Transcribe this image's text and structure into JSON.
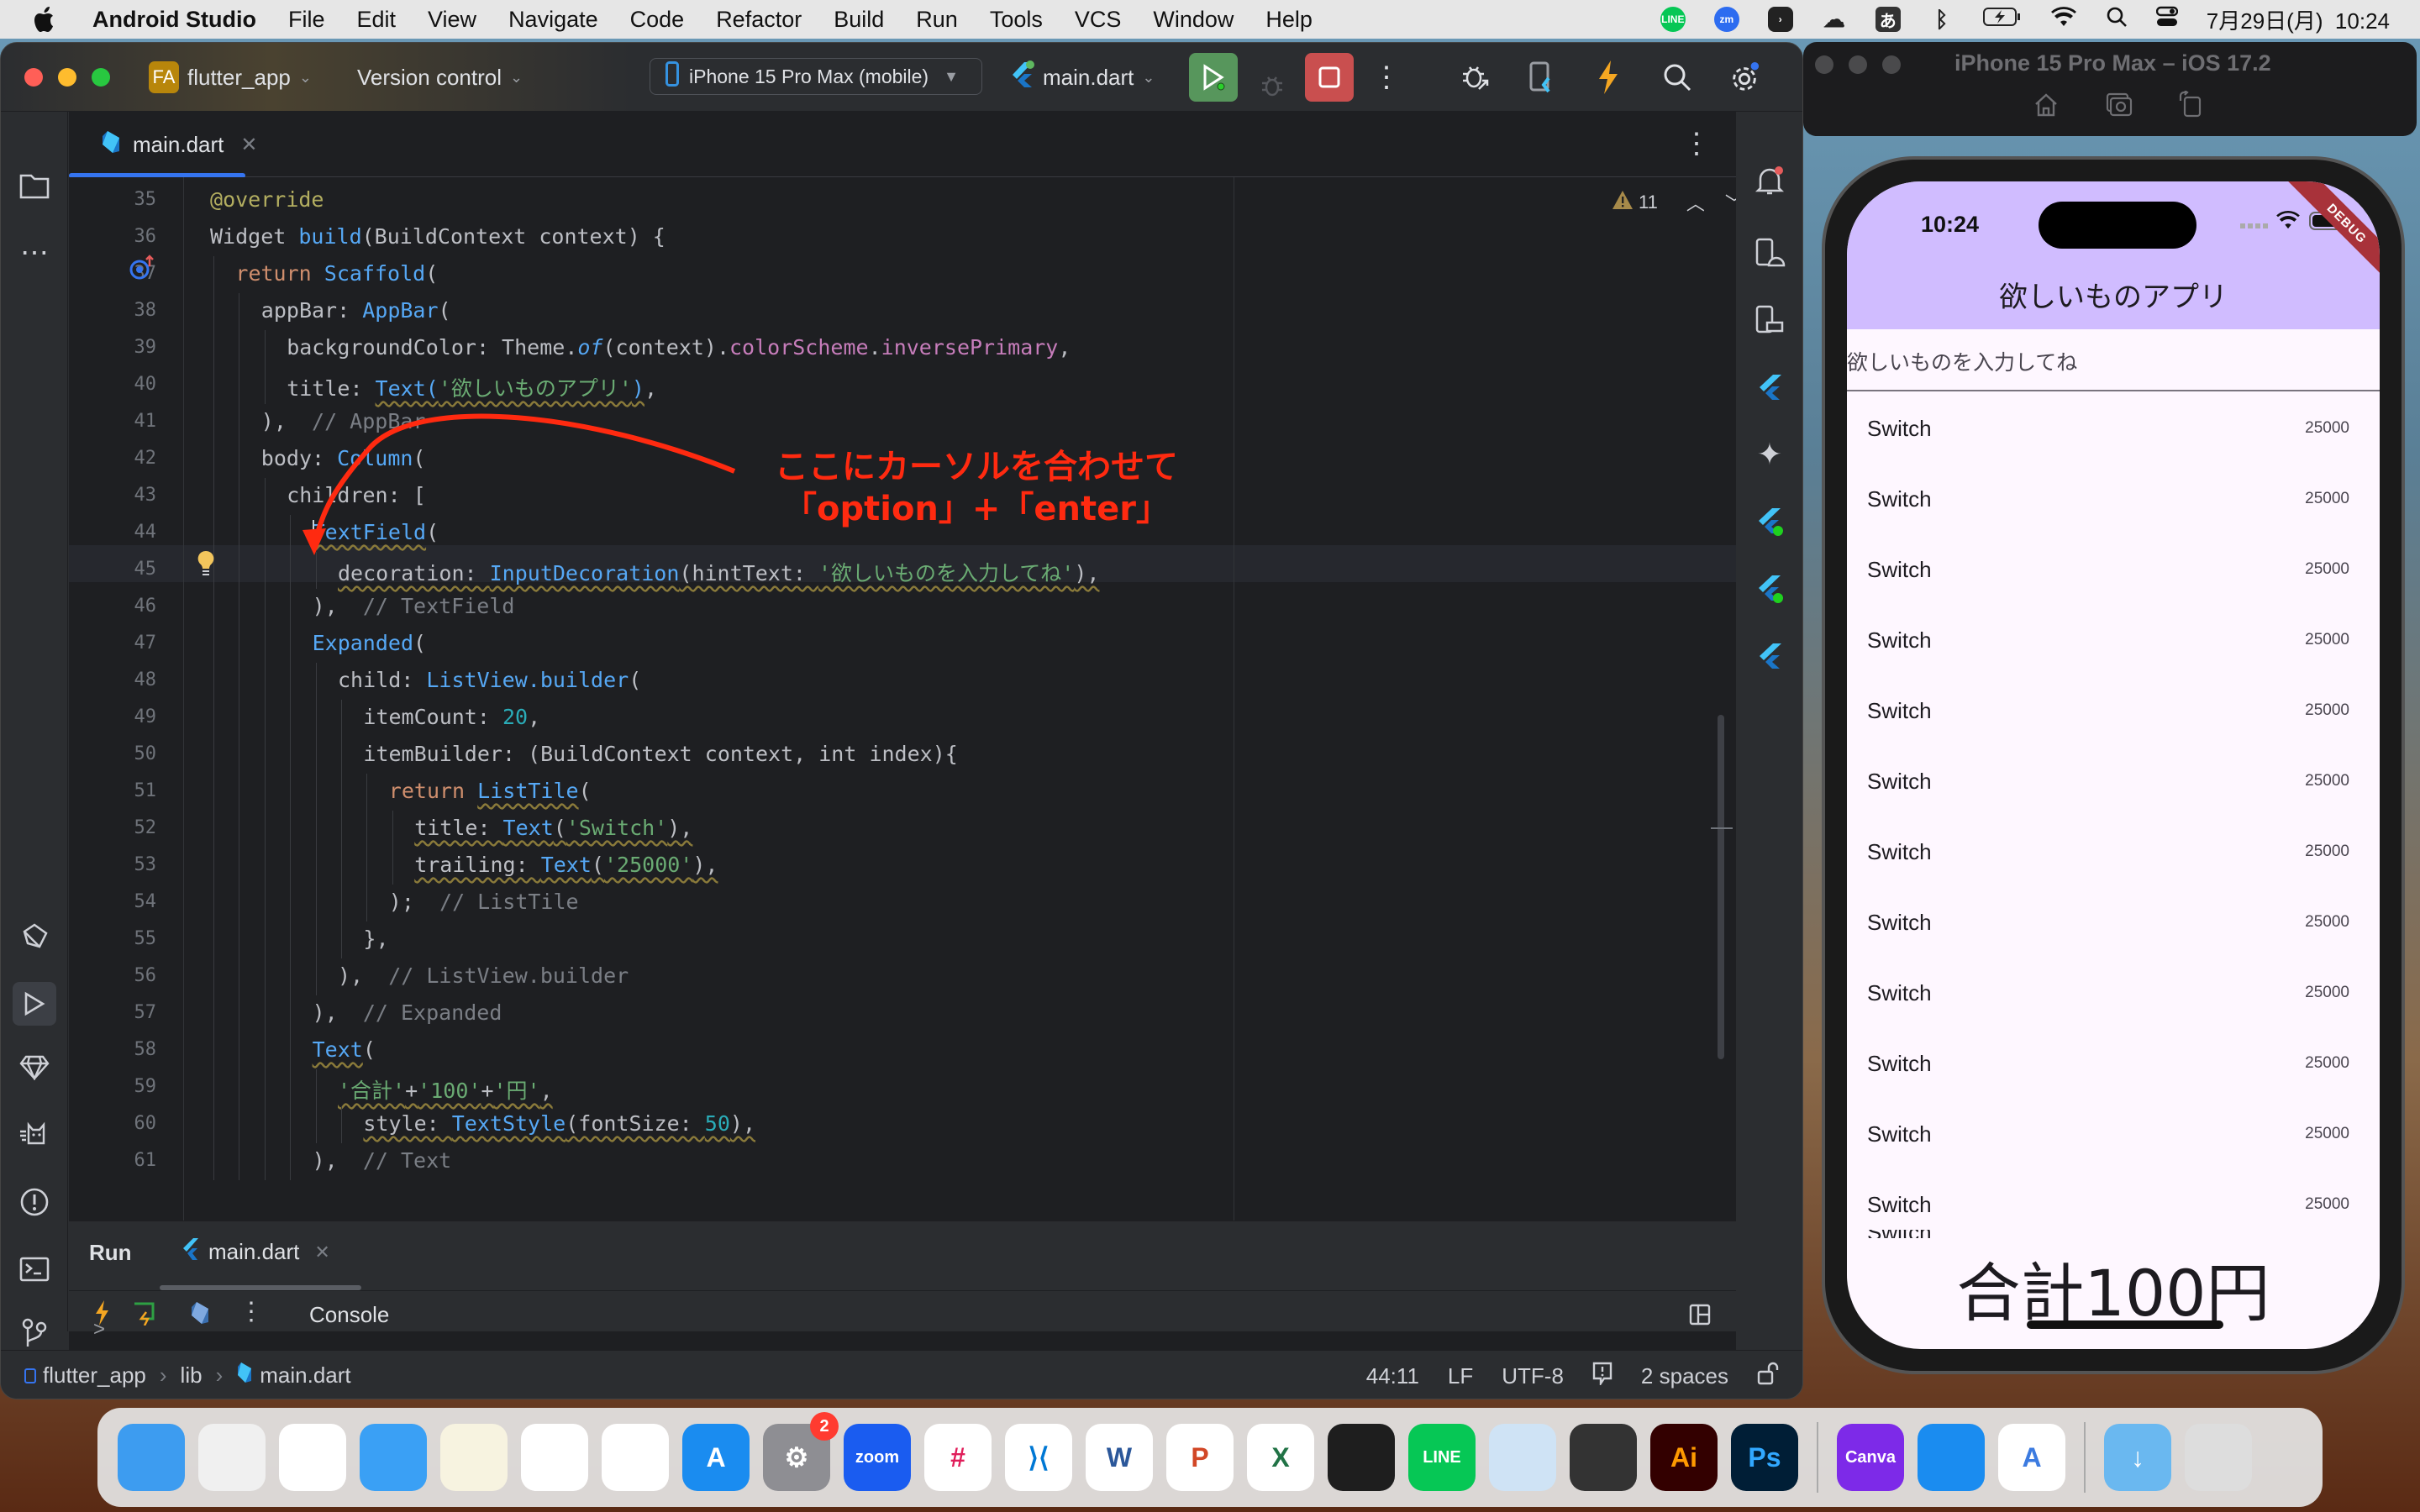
{
  "menubar": {
    "app_name": "Android Studio",
    "items": [
      "File",
      "Edit",
      "View",
      "Navigate",
      "Code",
      "Refactor",
      "Build",
      "Run",
      "Tools",
      "VCS",
      "Window",
      "Help"
    ],
    "status_icons": [
      "line-icon",
      "zoom-icon",
      "app-shield-icon",
      "creative-cloud-icon",
      "input-method-icon",
      "bluetooth-icon",
      "battery-icon",
      "wifi-icon",
      "spotlight-icon",
      "control-center-icon"
    ],
    "input_method": "あ",
    "datetime": "7月29日(月)  10:24"
  },
  "ide": {
    "project_badge": "FA",
    "project_name": "flutter_app",
    "version_control": "Version control",
    "device": "iPhone 15 Pro Max (mobile)",
    "run_config": "main.dart",
    "editor_tab": "main.dart",
    "warnings_count": "11",
    "cursor_annotation": {
      "line1": "ここにカーソルを合わせて",
      "line2": "「option」+「enter」",
      "color": "#ff2a10"
    },
    "code_lines": [
      {
        "n": "35",
        "indent": 1,
        "html": "<span class='ann'>@</span><span class='ann'>override</span>"
      },
      {
        "n": "36",
        "indent": 1,
        "html": "Widget <span class='fn'>build</span>(BuildContext context) {"
      },
      {
        "n": "37",
        "indent": 2,
        "html": "<span class='kw'>return</span> <span class='cls'>Scaffold</span>("
      },
      {
        "n": "38",
        "indent": 3,
        "html": "appBar: <span class='cls'>AppBar</span>("
      },
      {
        "n": "39",
        "indent": 4,
        "html": "backgroundColor: Theme.<span class='fn' style='font-style:italic'>of</span>(context).<span class='prop'>colorScheme</span>.<span class='prop'>inversePrimary</span>,"
      },
      {
        "n": "40",
        "indent": 4,
        "html": "title: <span class='cls sq'>Text(<span class='str'>'欲しいものアプリ'</span>)</span>,"
      },
      {
        "n": "41",
        "indent": 3,
        "html": "),  <span class='cm'>// AppBar</span>"
      },
      {
        "n": "42",
        "indent": 3,
        "html": "body: <span class='cls'>Column</span>("
      },
      {
        "n": "43",
        "indent": 4,
        "html": "children: ["
      },
      {
        "n": "44",
        "indent": 5,
        "html": "<span class='cls sq'>TextField</span>("
      },
      {
        "n": "45",
        "indent": 6,
        "html": "<span class='sq'>decoration: <span class='cls'>InputDecoration</span>(hintText: <span class='str'>'欲しいものを入力してね'</span>),</span>"
      },
      {
        "n": "46",
        "indent": 5,
        "html": "),  <span class='cm'>// TextField</span>"
      },
      {
        "n": "47",
        "indent": 5,
        "html": "<span class='cls'>Expanded</span>("
      },
      {
        "n": "48",
        "indent": 6,
        "html": "child: <span class='cls'>ListView.builder</span>("
      },
      {
        "n": "49",
        "indent": 7,
        "html": "itemCount: <span class='num'>20</span>,"
      },
      {
        "n": "50",
        "indent": 7,
        "html": "itemBuilder: (BuildContext context, int index){"
      },
      {
        "n": "51",
        "indent": 8,
        "html": "<span class='kw'>return</span> <span class='cls sq'>ListTile</span>("
      },
      {
        "n": "52",
        "indent": 9,
        "html": "<span class='sq'>title: <span class='cls'>Text</span>(<span class='str'>'Switch'</span>),</span>"
      },
      {
        "n": "53",
        "indent": 9,
        "html": "<span class='sq'>trailing: <span class='cls'>Text</span>(<span class='str'>'25000'</span>),</span>"
      },
      {
        "n": "54",
        "indent": 8,
        "html": ");  <span class='cm'>// ListTile</span>"
      },
      {
        "n": "55",
        "indent": 7,
        "html": "},"
      },
      {
        "n": "56",
        "indent": 6,
        "html": "),  <span class='cm'>// ListView.builder</span>"
      },
      {
        "n": "57",
        "indent": 5,
        "html": "),  <span class='cm'>// Expanded</span>"
      },
      {
        "n": "58",
        "indent": 5,
        "html": "<span class='cls sq'>Text</span>("
      },
      {
        "n": "59",
        "indent": 6,
        "html": "<span class='sq'><span class='str'>'合計'</span>+<span class='str'>'100'</span>+<span class='str'>'円'</span>,</span>"
      },
      {
        "n": "60",
        "indent": 7,
        "html": "<span class='sq'>style: <span class='cls'>TextStyle</span>(fontSize: <span class='num'>50</span>),</span>"
      },
      {
        "n": "61",
        "indent": 5,
        "html": "),  <span class='cm'>// Text</span>"
      }
    ],
    "run_panel": {
      "title": "Run",
      "tab": "main.dart",
      "console_label": "Console",
      "prompt": ">"
    },
    "status_bar": {
      "breadcrumb": [
        "flutter_app",
        "lib",
        "main.dart"
      ],
      "position": "44:11",
      "line_ending": "LF",
      "encoding": "UTF-8",
      "indent": "2 spaces"
    }
  },
  "simulator": {
    "title": "iPhone 15 Pro Max – iOS 17.2",
    "status_time": "10:24",
    "debug_banner": "DEBUG",
    "app_title": "欲しいものアプリ",
    "text_field_hint": "欲しいものを入力してね",
    "list_items": [
      {
        "title": "Switch",
        "trailing": "25000"
      },
      {
        "title": "Switch",
        "trailing": "25000"
      },
      {
        "title": "Switch",
        "trailing": "25000"
      },
      {
        "title": "Switch",
        "trailing": "25000"
      },
      {
        "title": "Switch",
        "trailing": "25000"
      },
      {
        "title": "Switch",
        "trailing": "25000"
      },
      {
        "title": "Switch",
        "trailing": "25000"
      },
      {
        "title": "Switch",
        "trailing": "25000"
      },
      {
        "title": "Switch",
        "trailing": "25000"
      },
      {
        "title": "Switch",
        "trailing": "25000"
      },
      {
        "title": "Switch",
        "trailing": "25000"
      },
      {
        "title": "Switch",
        "trailing": "25000"
      }
    ],
    "total_text": "合計100円",
    "appbar_color": "#d0bcff"
  },
  "dock": {
    "apps": [
      {
        "name": "finder",
        "label": "",
        "bg": "#3d9cf0"
      },
      {
        "name": "launchpad",
        "label": "",
        "bg": "#f0f0f0"
      },
      {
        "name": "safari",
        "label": "",
        "bg": "#ffffff"
      },
      {
        "name": "mail",
        "label": "",
        "bg": "#3aa0f5"
      },
      {
        "name": "notes",
        "label": "",
        "bg": "#f7f3e0"
      },
      {
        "name": "freeform",
        "label": "",
        "bg": "#ffffff"
      },
      {
        "name": "chrome",
        "label": "",
        "bg": "#ffffff"
      },
      {
        "name": "app-store",
        "label": "A",
        "bg": "#1a8cf0"
      },
      {
        "name": "system-settings",
        "label": "⚙",
        "bg": "#8e8e93",
        "badge": "2"
      },
      {
        "name": "zoom",
        "label": "zoom",
        "bg": "#1a5cf0"
      },
      {
        "name": "slack",
        "label": "#",
        "bg": "#ffffff"
      },
      {
        "name": "vscode",
        "label": "⟩⟨",
        "bg": "#ffffff"
      },
      {
        "name": "word",
        "label": "W",
        "bg": "#ffffff"
      },
      {
        "name": "powerpoint",
        "label": "P",
        "bg": "#ffffff"
      },
      {
        "name": "excel",
        "label": "X",
        "bg": "#ffffff"
      },
      {
        "name": "figma",
        "label": "",
        "bg": "#1e1e1e"
      },
      {
        "name": "line",
        "label": "LINE",
        "bg": "#06c755"
      },
      {
        "name": "preview",
        "label": "",
        "bg": "#cfe3f5"
      },
      {
        "name": "final-cut-pro",
        "label": "",
        "bg": "#333333"
      },
      {
        "name": "illustrator",
        "label": "Ai",
        "bg": "#330000"
      },
      {
        "name": "photoshop",
        "label": "Ps",
        "bg": "#001e36"
      },
      {
        "sep": true
      },
      {
        "name": "canva",
        "label": "Canva",
        "bg": "#7d2ae8"
      },
      {
        "name": "xcode-simulator",
        "label": "",
        "bg": "#1a8cf0"
      },
      {
        "name": "android-studio",
        "label": "A",
        "bg": "#ffffff"
      },
      {
        "sep": true
      },
      {
        "name": "downloads-folder",
        "label": "↓",
        "bg": "#6ab8f0"
      },
      {
        "name": "trash",
        "label": "",
        "bg": "#dddddd"
      }
    ]
  }
}
